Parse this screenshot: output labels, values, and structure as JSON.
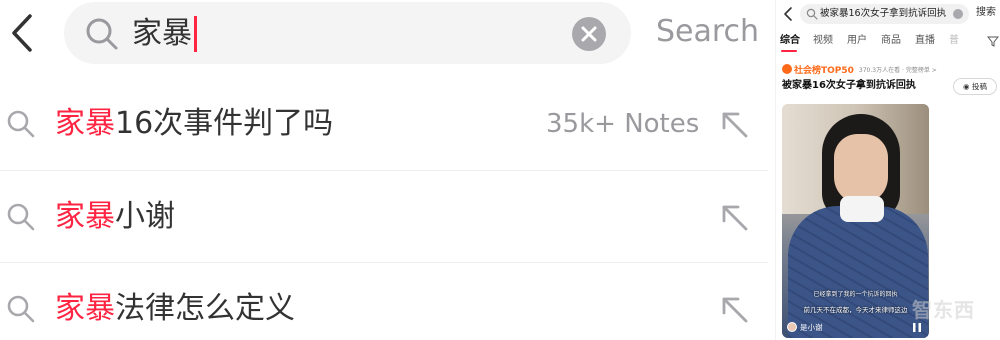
{
  "left_panel": {
    "search": {
      "query": "家暴",
      "action_label": "Search"
    },
    "suggestions": [
      {
        "highlight": "家暴",
        "rest": "16次事件判了吗",
        "count": "35k+ Notes"
      },
      {
        "highlight": "家暴",
        "rest": "小谢",
        "count": ""
      },
      {
        "highlight": "家暴",
        "rest": "法律怎么定义",
        "count": ""
      }
    ],
    "colors": {
      "highlight": "#ff2442",
      "muted": "#9a9a9e",
      "pill_bg": "#f4f4f5"
    },
    "icons": [
      "back-chevron-icon",
      "search-icon",
      "clear-icon",
      "fill-arrow-icon"
    ]
  },
  "right_panel": {
    "search": {
      "query": "被家暴16次女子拿到抗诉回执",
      "action_label": "搜索"
    },
    "tabs": [
      "综合",
      "视频",
      "用户",
      "商品",
      "直播",
      "普"
    ],
    "active_tab": "综合",
    "rank": {
      "title": "社会榜TOP50",
      "meta": "370.3万人在看 · 完整榜单 >"
    },
    "headline": "被家暴16次女子拿到抗诉回执",
    "post_button": "投稿",
    "video": {
      "subtitle_line1": "已经拿到了我的一个抗诉的回执",
      "subtitle_line2": "前几天不在成都，今天才来律师这边",
      "author": "是小谢"
    },
    "watermark": "智东西",
    "colors": {
      "accent": "#ff2442",
      "rank": "#ff6a1a"
    }
  }
}
